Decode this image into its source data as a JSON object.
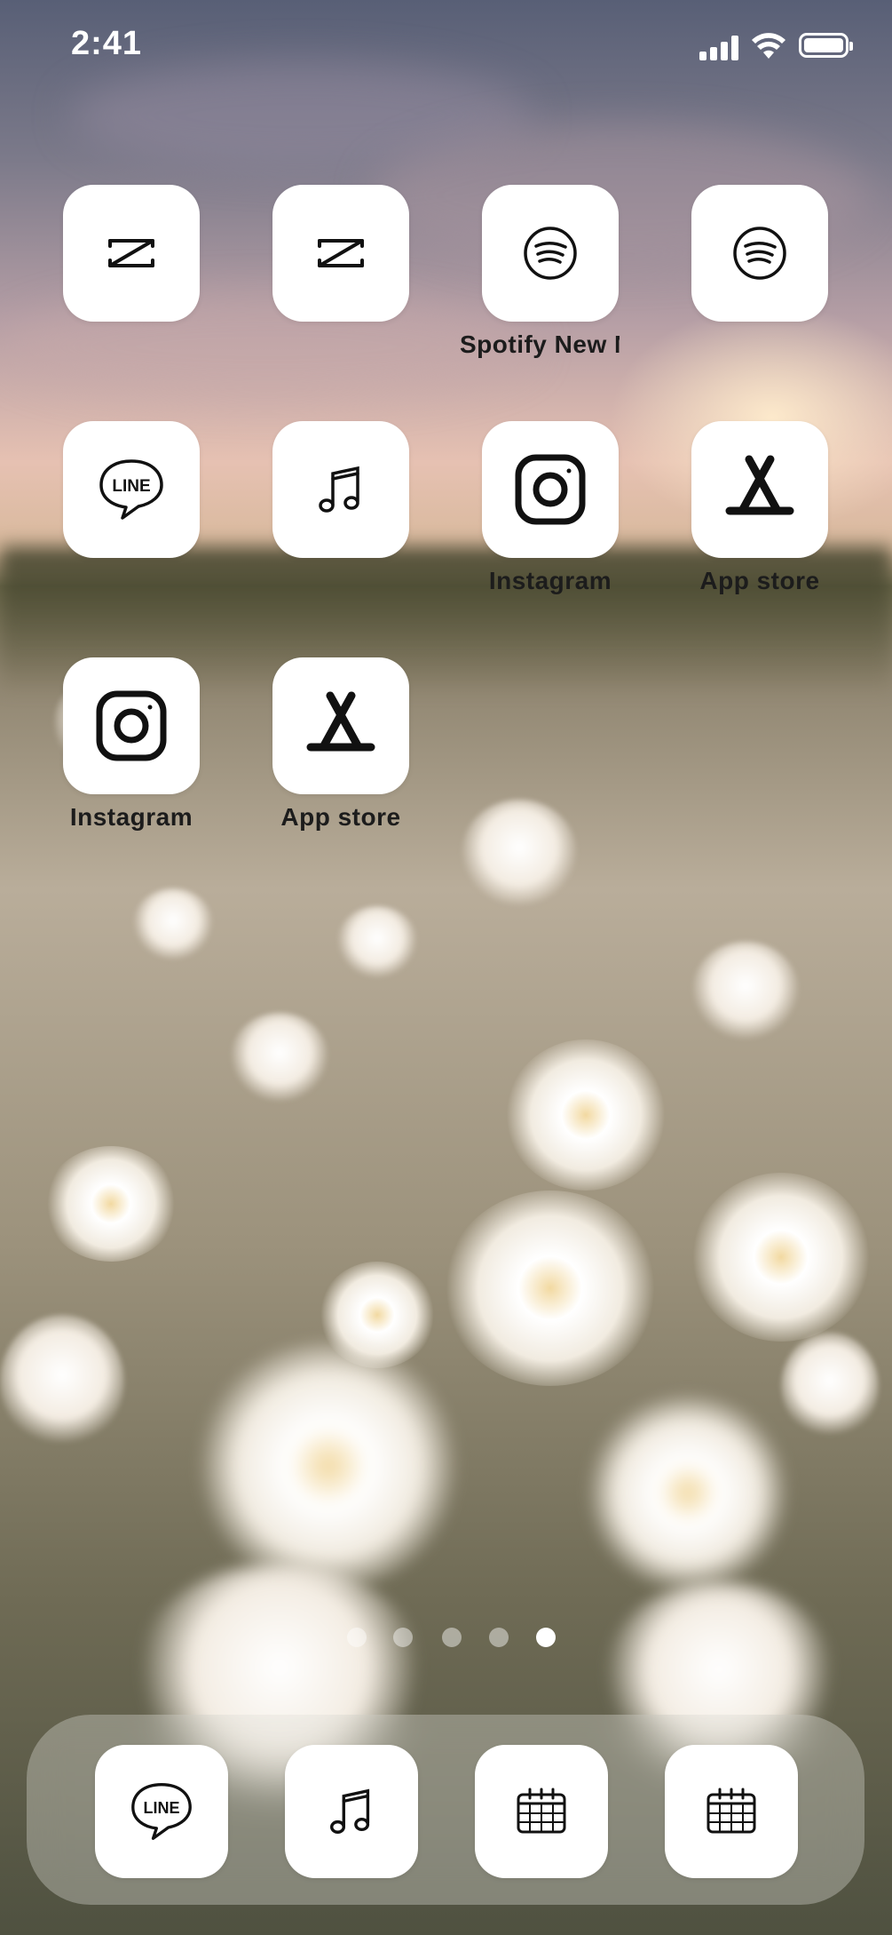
{
  "status_bar": {
    "time": "2:41"
  },
  "apps": [
    {
      "icon": "capcut-icon",
      "label": ""
    },
    {
      "icon": "capcut-icon",
      "label": ""
    },
    {
      "icon": "spotify-icon",
      "label": "Spotify New M"
    },
    {
      "icon": "spotify-icon",
      "label": ""
    },
    {
      "icon": "line-icon",
      "label": "",
      "icon_text": "LINE"
    },
    {
      "icon": "music-note-icon",
      "label": ""
    },
    {
      "icon": "instagram-icon",
      "label": "Instagram"
    },
    {
      "icon": "app-store-icon",
      "label": "App store"
    },
    {
      "icon": "instagram-icon",
      "label": "Instagram"
    },
    {
      "icon": "app-store-icon",
      "label": "App store"
    }
  ],
  "page_indicator": {
    "pages": 5,
    "current": 5
  },
  "dock": [
    {
      "icon": "line-icon",
      "icon_text": "LINE"
    },
    {
      "icon": "music-note-icon"
    },
    {
      "icon": "calendar-icon"
    },
    {
      "icon": "calendar-icon"
    }
  ]
}
